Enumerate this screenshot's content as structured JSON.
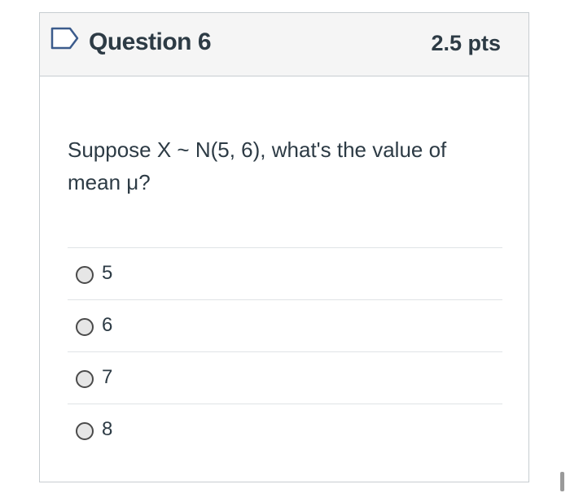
{
  "question": {
    "title": "Question 6",
    "points": "2.5 pts",
    "flag_icon": "bookmark-flag-icon",
    "text": "Suppose X ~ N(5, 6), what's the value of mean μ?",
    "answers": [
      {
        "label": "5",
        "selected": false
      },
      {
        "label": "6",
        "selected": false
      },
      {
        "label": "7",
        "selected": false
      },
      {
        "label": "8",
        "selected": false
      }
    ]
  },
  "colors": {
    "header_bg": "#f5f5f5",
    "border": "#c7cdd1",
    "text": "#2d3b45",
    "flag": "#3b5b8c"
  }
}
